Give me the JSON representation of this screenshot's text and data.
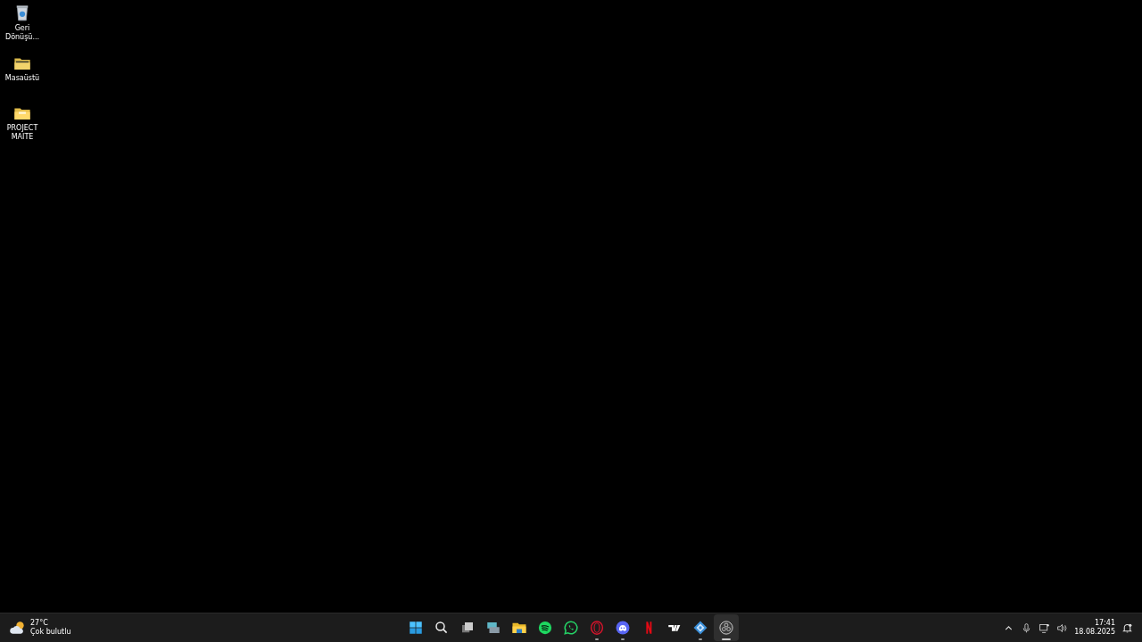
{
  "desktop_icons": [
    {
      "kind": "recycle-bin",
      "label": "Geri Dönüşü..."
    },
    {
      "kind": "dark-folder",
      "label": "Masaüstü"
    },
    {
      "kind": "folder",
      "label": "PROJECT MAITE"
    }
  ],
  "taskbar": {
    "weather": {
      "temperature": "27°C",
      "condition": "Çok bulutlu"
    },
    "apps": [
      {
        "kind": "start",
        "running": false,
        "selected": false
      },
      {
        "kind": "search",
        "running": false,
        "selected": false
      },
      {
        "kind": "task-view",
        "running": false,
        "selected": false
      },
      {
        "kind": "widgets",
        "running": false,
        "selected": false
      },
      {
        "kind": "explorer",
        "running": false,
        "selected": false
      },
      {
        "kind": "spotify",
        "running": false,
        "selected": false
      },
      {
        "kind": "whatsapp",
        "running": false,
        "selected": false
      },
      {
        "kind": "opera",
        "running": true,
        "selected": false
      },
      {
        "kind": "discord",
        "running": true,
        "selected": false
      },
      {
        "kind": "netflix",
        "running": false,
        "selected": false
      },
      {
        "kind": "tradingview",
        "running": false,
        "selected": false
      },
      {
        "kind": "blue-app",
        "running": true,
        "selected": false
      },
      {
        "kind": "obs",
        "running": true,
        "selected": true
      }
    ],
    "tray": {
      "time": "17:41",
      "date": "18.08.2025"
    }
  }
}
